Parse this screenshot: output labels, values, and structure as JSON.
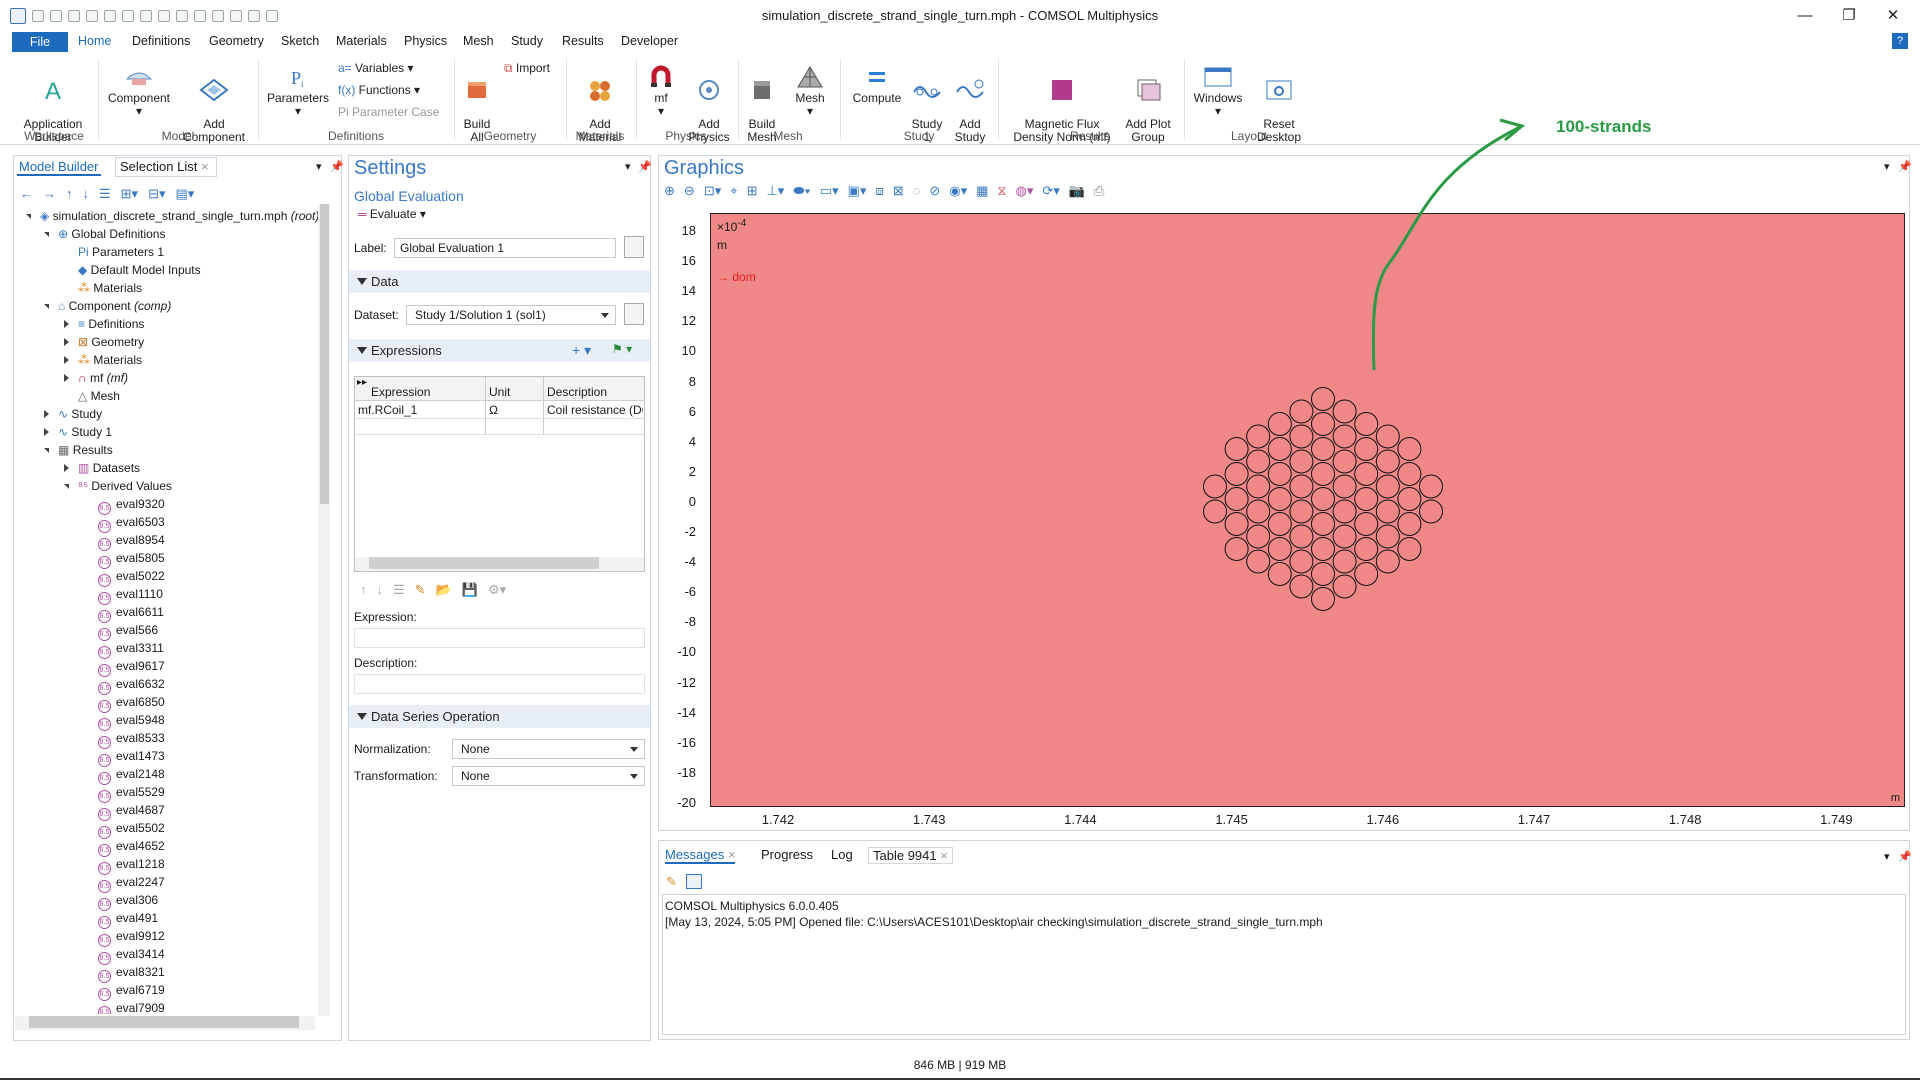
{
  "window": {
    "title": "simulation_discrete_strand_single_turn.mph - COMSOL Multiphysics",
    "controls": [
      "—",
      "❐",
      "✕"
    ]
  },
  "menu": {
    "file": "File",
    "tabs": [
      "Home",
      "Definitions",
      "Geometry",
      "Sketch",
      "Materials",
      "Physics",
      "Mesh",
      "Study",
      "Results",
      "Developer"
    ],
    "help": "?"
  },
  "ribbon": {
    "app_builder": "Application\nBuilder",
    "component": "Component",
    "add_component": "Add\nComponent",
    "parameters": "Parameters",
    "variables": "Variables",
    "functions": "Functions",
    "parameter_case": "Parameter Case",
    "build_all": "Build\nAll",
    "import": "Import",
    "add_material": "Add\nMaterial",
    "mf": "mf",
    "add_physics": "Add\nPhysics",
    "build_mesh": "Build\nMesh",
    "mesh": "Mesh",
    "compute": "Compute",
    "study1": "Study\n1",
    "add_study": "Add\nStudy",
    "magnetic_flux": "Magnetic Flux\nDensity Norm (mf)",
    "add_plot_group": "Add Plot\nGroup",
    "windows": "Windows",
    "reset_desktop": "Reset\nDesktop",
    "groups": {
      "workspace": "Workspace",
      "model": "Model",
      "definitions": "Definitions",
      "geometry": "Geometry",
      "materials": "Materials",
      "physics": "Physics",
      "mesh": "Mesh",
      "study": "Study",
      "results": "Results",
      "layout": "Layout"
    }
  },
  "model_builder": {
    "tab_active": "Model Builder",
    "tab_other": "Selection List",
    "root": "simulation_discrete_strand_single_turn.mph",
    "root_suffix": "(root)",
    "global_definitions": "Global Definitions",
    "parameters1": "Parameters 1",
    "default_model_inputs": "Default Model Inputs",
    "materials_global": "Materials",
    "component": "Component",
    "component_suffix": "(comp)",
    "definitions": "Definitions",
    "geometry": "Geometry",
    "materials": "Materials",
    "mf": "mf",
    "mf_suffix": "(mf)",
    "mesh": "Mesh",
    "study": "Study",
    "study1": "Study 1",
    "results": "Results",
    "datasets": "Datasets",
    "derived_values": "Derived Values",
    "evals": [
      "eval9320",
      "eval6503",
      "eval8954",
      "eval5805",
      "eval5022",
      "eval1110",
      "eval6611",
      "eval566",
      "eval3311",
      "eval9617",
      "eval6632",
      "eval6850",
      "eval5948",
      "eval8533",
      "eval1473",
      "eval2148",
      "eval5529",
      "eval4687",
      "eval5502",
      "eval4652",
      "eval1218",
      "eval2247",
      "eval306",
      "eval491",
      "eval9912",
      "eval3414",
      "eval8321",
      "eval6719",
      "eval7909"
    ]
  },
  "settings": {
    "title": "Settings",
    "subtitle": "Global Evaluation",
    "evaluate": "Evaluate",
    "label_caption": "Label:",
    "label_value": "Global Evaluation 1",
    "data_section": "Data",
    "dataset_caption": "Dataset:",
    "dataset_value": "Study 1/Solution 1 (sol1)",
    "expressions_section": "Expressions",
    "col_expression": "Expression",
    "col_unit": "Unit",
    "col_description": "Description",
    "row_expression": "mf.RCoil_1",
    "row_unit": "Ω",
    "row_description": "Coil resistance (DC",
    "expression_caption": "Expression:",
    "description_caption": "Description:",
    "dso_section": "Data Series Operation",
    "normalization_caption": "Normalization:",
    "normalization_value": "None",
    "transformation_caption": "Transformation:",
    "transformation_value": "None"
  },
  "graphics": {
    "title": "Graphics",
    "exponent": "×10",
    "exponent_power": "-4",
    "unit_y": "m",
    "unit_x": "m",
    "dom_label": "dom",
    "annotation": "100-strands",
    "plot_color": "#f08888",
    "y_ticks": [
      "18",
      "16",
      "14",
      "12",
      "10",
      "8",
      "6",
      "4",
      "2",
      "0",
      "-2",
      "-4",
      "-6",
      "-8",
      "-10",
      "-12",
      "-14",
      "-16",
      "-18",
      "-20"
    ],
    "x_ticks": [
      "1.742",
      "1.743",
      "1.744",
      "1.745",
      "1.746",
      "1.747",
      "1.748",
      "1.749"
    ]
  },
  "messages": {
    "tabs": [
      "Messages",
      "Progress",
      "Log",
      "Table 9941"
    ],
    "line1": "COMSOL Multiphysics 6.0.0.405",
    "line2": "[May 13, 2024, 5:05 PM] Opened file: C:\\Users\\ACES101\\Desktop\\air checking\\simulation_discrete_strand_single_turn.mph"
  },
  "status": {
    "memory": "846 MB | 919 MB"
  }
}
